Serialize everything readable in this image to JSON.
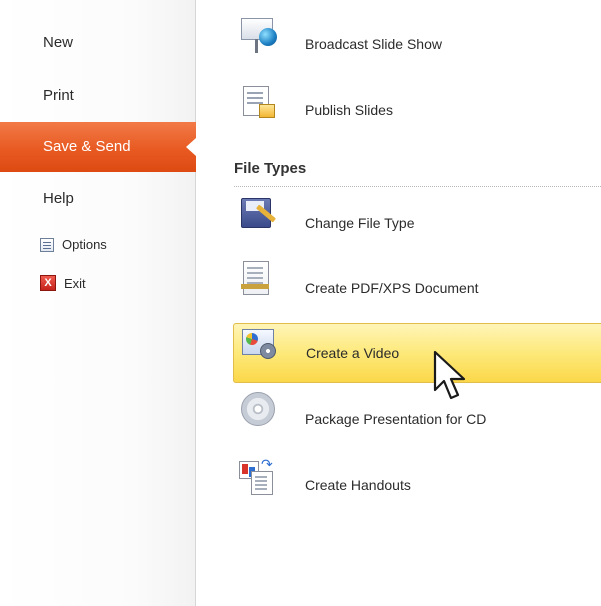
{
  "nav": {
    "items": [
      {
        "label": "New"
      },
      {
        "label": "Print"
      },
      {
        "label": "Save & Send",
        "selected": true
      },
      {
        "label": "Help"
      }
    ],
    "options_label": "Options",
    "exit_label": "Exit",
    "exit_glyph": "X"
  },
  "share": {
    "commands": [
      {
        "label": "Broadcast Slide Show",
        "icon": "broadcast-slideshow-icon"
      },
      {
        "label": "Publish Slides",
        "icon": "publish-slides-icon"
      }
    ]
  },
  "file_types": {
    "heading": "File Types",
    "commands": [
      {
        "label": "Change File Type",
        "icon": "change-file-type-icon"
      },
      {
        "label": "Create PDF/XPS Document",
        "icon": "pdf-document-icon"
      },
      {
        "label": "Create a Video",
        "icon": "video-icon",
        "hovered": true
      },
      {
        "label": "Package Presentation for CD",
        "icon": "cd-icon"
      },
      {
        "label": "Create Handouts",
        "icon": "handouts-icon"
      }
    ]
  },
  "colors": {
    "selected_nav": "#e85a22",
    "hover_highlight": "#fde97a",
    "hover_border": "#e3bd4a"
  }
}
